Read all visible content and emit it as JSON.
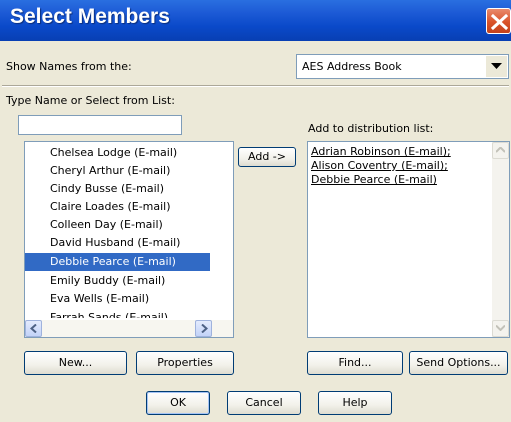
{
  "window": {
    "title": "Select Members",
    "close_icon": "close-x-icon"
  },
  "show_names": {
    "label": "Show Names from the:",
    "selected": "AES Address Book"
  },
  "type_name": {
    "label": "Type Name or Select from List:",
    "value": ""
  },
  "name_list": {
    "items": [
      "Chelsea Lodge (E-mail)",
      "Cheryl Arthur (E-mail)",
      "Cindy Busse (E-mail)",
      "Claire Loades (E-mail)",
      "Colleen Day (E-mail)",
      "David Husband (E-mail)",
      "Debbie Pearce (E-mail)",
      "Emily Buddy (E-mail)",
      "Eva Wells (E-mail)",
      "Farrah Sands (E-mail)"
    ],
    "selected_index": 6
  },
  "add": {
    "label": "Add ->"
  },
  "distribution": {
    "label": "Add to distribution list:",
    "text": "Adrian Robinson (E-mail);\nAlison Coventry (E-mail);\nDebbie Pearce (E-mail)"
  },
  "buttons": {
    "new": "New...",
    "properties": "Properties",
    "find": "Find...",
    "send_options": "Send Options...",
    "ok": "OK",
    "cancel": "Cancel",
    "help": "Help"
  },
  "colors": {
    "titlebar": "#0a49c9",
    "selection": "#316ac5",
    "dialog_bg": "#ece9d8"
  }
}
